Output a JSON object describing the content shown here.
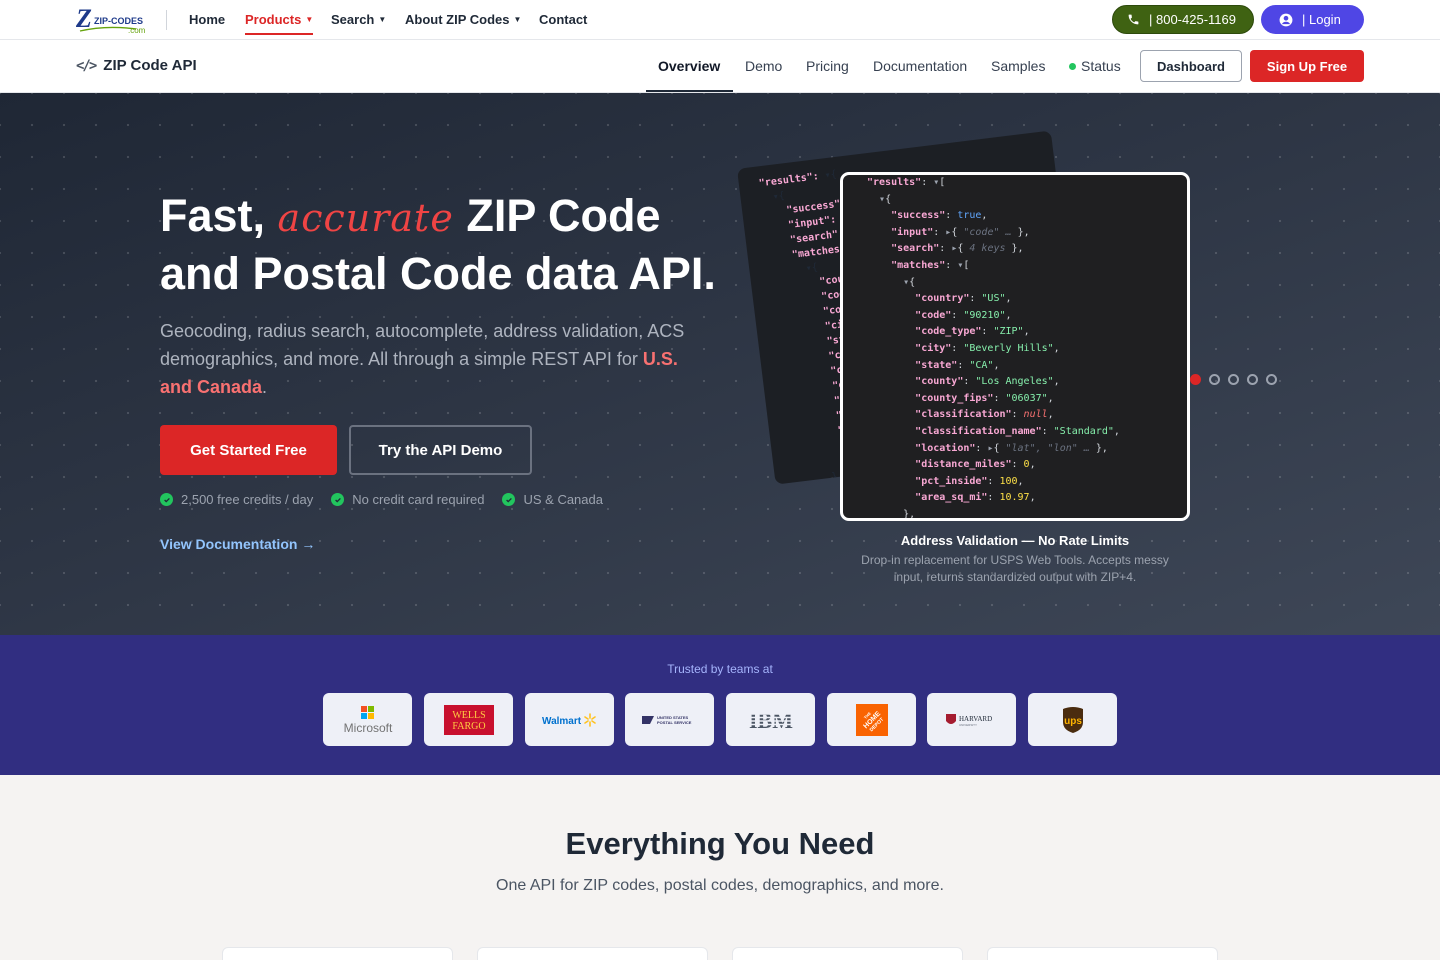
{
  "topnav": {
    "logo": {
      "word": "ZIP-CODES",
      "domain": ".com"
    },
    "links": [
      {
        "label": "Home",
        "caret": false,
        "active": false
      },
      {
        "label": "Products",
        "caret": true,
        "active": true
      },
      {
        "label": "Search",
        "caret": true,
        "active": false
      },
      {
        "label": "About ZIP Codes",
        "caret": true,
        "active": false
      },
      {
        "label": "Contact",
        "caret": false,
        "active": false
      }
    ],
    "phone": "| 800-425-1169",
    "login": "|  Login"
  },
  "subnav": {
    "brand": "ZIP Code API",
    "links": [
      "Overview",
      "Demo",
      "Pricing",
      "Documentation",
      "Samples",
      "Status"
    ],
    "dashboard": "Dashboard",
    "signup": "Sign Up Free"
  },
  "hero": {
    "title_pre": "Fast, ",
    "title_accent": "accurate",
    "title_post": " ZIP Code and Postal Code data API.",
    "subtitle_pre": "Geocoding, radius search, autocomplete, address validation, ACS demographics, and more. All through a simple REST API for ",
    "subtitle_highlight": "U.S. and Canada",
    "subtitle_post": ".",
    "cta_primary": "Get Started Free",
    "cta_secondary": "Try the API Demo",
    "checks": [
      "2,500 free credits / day",
      "No credit card required",
      "US & Canada"
    ],
    "docs_link": "View Documentation →",
    "carousel": {
      "title": "Address Validation — No Rate Limits",
      "description": "Drop-in replacement for USPS Web Tools. Accepts messy input, returns standardized output with ZIP+4.",
      "slides": 5,
      "active_slide": 0
    },
    "code_back": [
      "\"results\": ▾{",
      "  ▾{",
      "    \"success\":",
      "    \"input\":",
      "    \"search\":",
      "    \"matches\"",
      "      ▾{",
      "        \"cou",
      "        \"cod",
      "        \"cod",
      "        \"cit",
      "        \"sta",
      "        \"co",
      "        \"co",
      "        \"c",
      "        \"c",
      "        \"l",
      "        \"",
      "        \"",
      "        \"",
      "      },"
    ],
    "code_front": {
      "results_key": "\"results\"",
      "success_val": "true",
      "input_hint": "\"code\" …",
      "search_hint": "4 keys",
      "fields": [
        {
          "key": "\"country\"",
          "val": "\"US\"",
          "type": "s"
        },
        {
          "key": "\"code\"",
          "val": "\"90210\"",
          "type": "s"
        },
        {
          "key": "\"code_type\"",
          "val": "\"ZIP\"",
          "type": "s"
        },
        {
          "key": "\"city\"",
          "val": "\"Beverly Hills\"",
          "type": "s"
        },
        {
          "key": "\"state\"",
          "val": "\"CA\"",
          "type": "s"
        },
        {
          "key": "\"county\"",
          "val": "\"Los Angeles\"",
          "type": "s"
        },
        {
          "key": "\"county_fips\"",
          "val": "\"06037\"",
          "type": "s"
        },
        {
          "key": "\"classification\"",
          "val": "null",
          "type": "nl"
        },
        {
          "key": "\"classification_name\"",
          "val": "\"Standard\"",
          "type": "s"
        }
      ],
      "location_hint": "\"lat\", \"lon\" …",
      "fields_after": [
        {
          "key": "\"distance_miles\"",
          "val": "0",
          "type": "n"
        },
        {
          "key": "\"pct_inside\"",
          "val": "100",
          "type": "n"
        },
        {
          "key": "\"area_sq_mi\"",
          "val": "10.97",
          "type": "n"
        }
      ]
    }
  },
  "trusted": {
    "label": "Trusted by teams at",
    "logos": [
      {
        "name": "Microsoft",
        "text": "Microsoft"
      },
      {
        "name": "Wells Fargo",
        "text": "WELLS FARGO"
      },
      {
        "name": "Walmart",
        "text": "Walmart"
      },
      {
        "name": "USPS",
        "text": "UNITED STATES POSTAL SERVICE"
      },
      {
        "name": "IBM",
        "text": "IBM"
      },
      {
        "name": "The Home Depot",
        "text": "THE HOME DEPOT"
      },
      {
        "name": "Harvard",
        "text": "HARVARD"
      },
      {
        "name": "UPS",
        "text": "ups"
      }
    ]
  },
  "features": {
    "title": "Everything You Need",
    "subtitle": "One API for ZIP codes, postal codes, demographics, and more."
  },
  "colors": {
    "brand_red": "#dc2626",
    "brand_indigo": "#312e81",
    "phone_green": "#3f6212",
    "login_blue": "#4f46e5"
  }
}
